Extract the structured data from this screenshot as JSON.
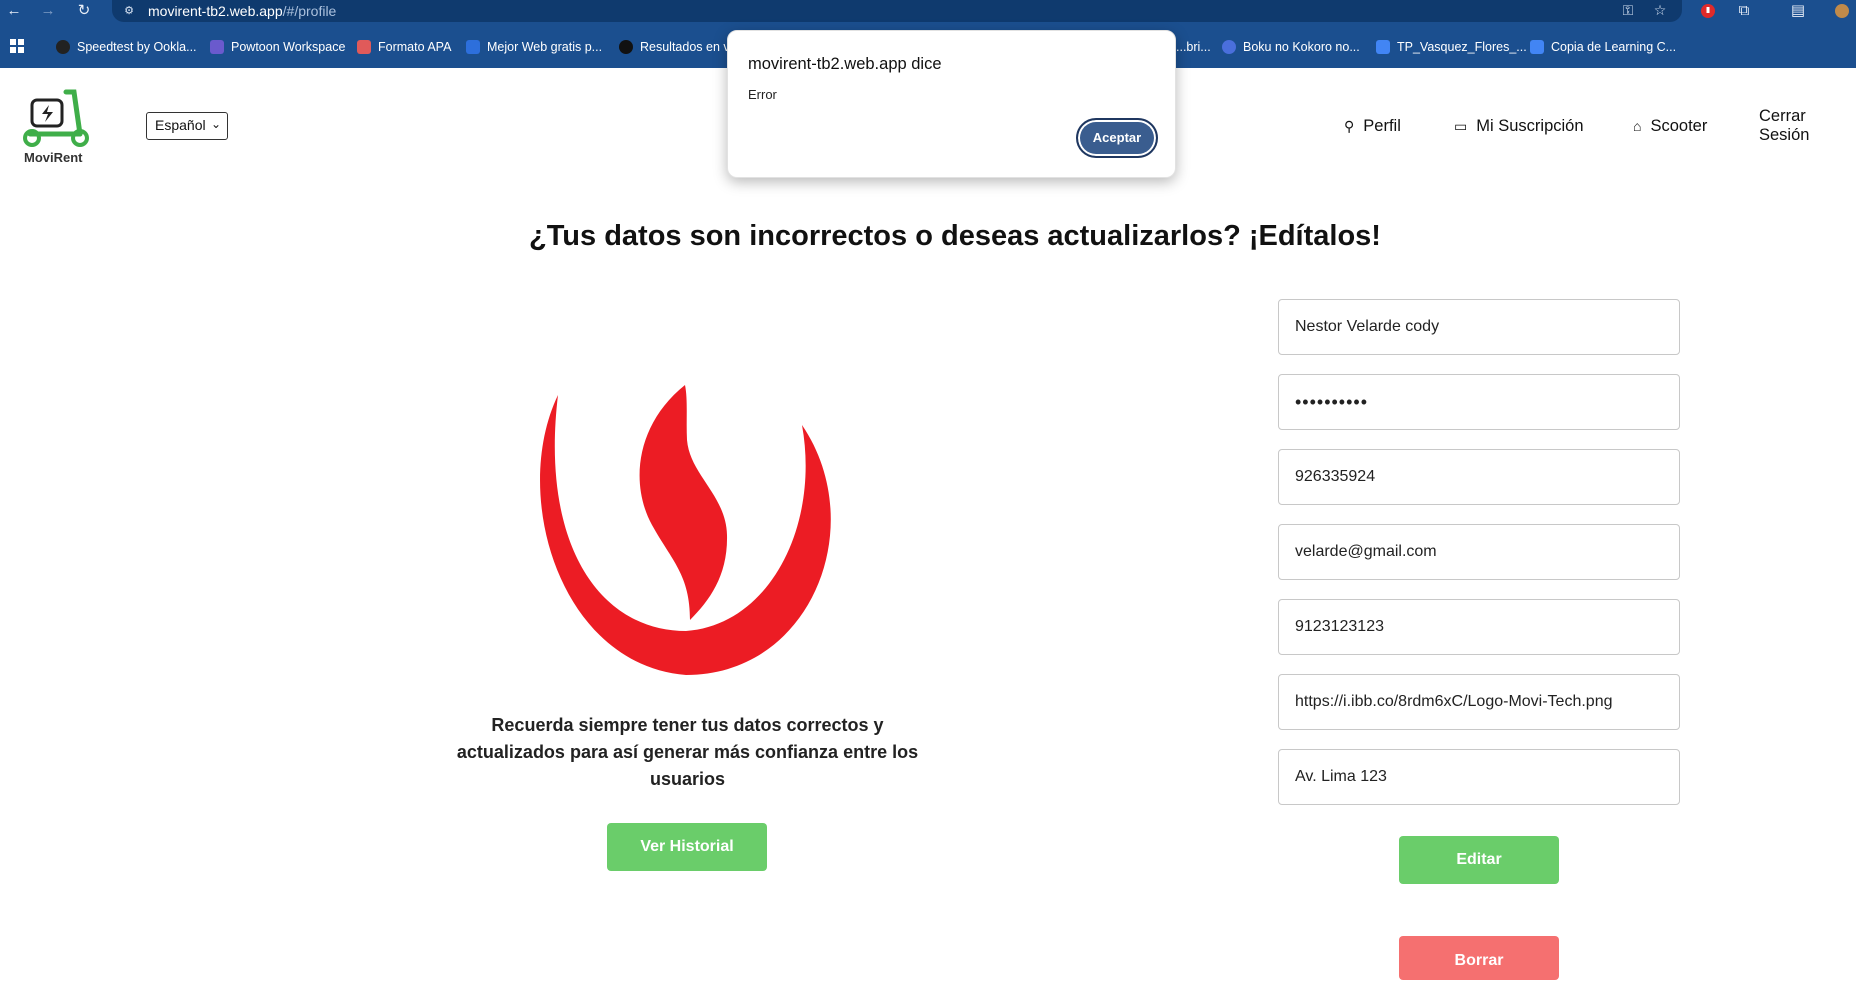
{
  "browser": {
    "url_host": "movirent-tb2.web.app",
    "url_path": "/#/profile",
    "bookmarks": [
      {
        "label": "Speedtest by Ookla...",
        "color": "#222222"
      },
      {
        "label": "Powtoon Workspace",
        "color": "#6a5acd"
      },
      {
        "label": "Formato APA",
        "color": "#e05a5a"
      },
      {
        "label": "Mejor Web gratis p...",
        "color": "#2d6fdc"
      },
      {
        "label": "Resultados en vi",
        "color": "#111111"
      },
      {
        "label": "...bri...",
        "color": "#3a7bd5"
      },
      {
        "label": "Boku no Kokoro no...",
        "color": "#4a6fdc"
      },
      {
        "label": "TP_Vasquez_Flores_...",
        "color": "#4285f4"
      },
      {
        "label": "Copia de Learning C...",
        "color": "#4285f4"
      }
    ]
  },
  "app": {
    "logo_text": "MoviRent",
    "language": "Español",
    "nav": {
      "profile": "Perfil",
      "subscription": "Mi Suscripción",
      "scooter": "Scooter",
      "logout": "Cerrar Sesión"
    }
  },
  "page": {
    "headline": "¿Tus datos son incorrectos o deseas actualizarlos? ¡Edítalos!",
    "reminder": "Recuerda siempre tener tus datos correctos y actualizados para así generar más confianza entre los usuarios",
    "history_button": "Ver Historial",
    "edit_button": "Editar",
    "delete_button": "Borrar"
  },
  "form": {
    "name": "Nestor Velarde cody",
    "password": "••••••••••",
    "phone": "926335924",
    "email": "velarde@gmail.com",
    "dni": "9123123123",
    "photo_url": "https://i.ibb.co/8rdm6xC/Logo-Movi-Tech.png",
    "address": "Av. Lima 123"
  },
  "dialog": {
    "title": "movirent-tb2.web.app dice",
    "message": "Error",
    "ok_button": "Aceptar"
  },
  "colors": {
    "chrome": "#1b4f8f",
    "brand_green": "#6acd6a",
    "danger_red": "#f57070",
    "upc_red": "#ec1c24",
    "dialog_button": "#3a5d8f"
  }
}
